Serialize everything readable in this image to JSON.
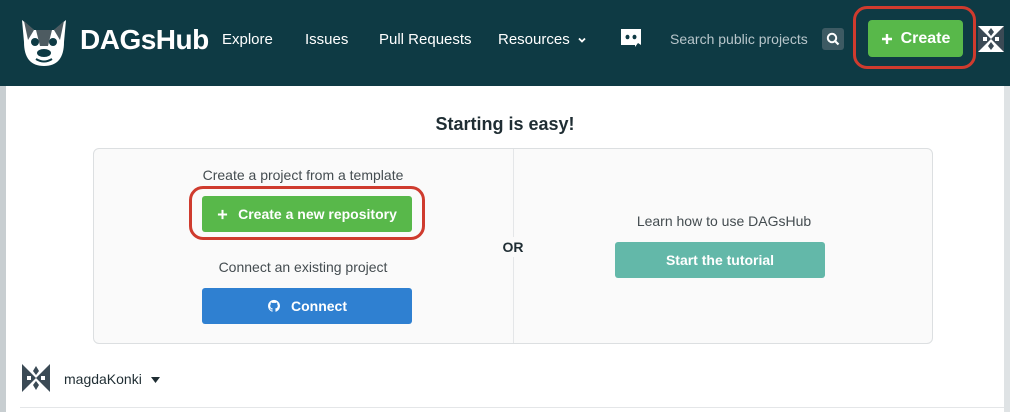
{
  "app": {
    "brand": "DAGsHub"
  },
  "nav": {
    "items": [
      {
        "label": "Explore"
      },
      {
        "label": "Issues"
      },
      {
        "label": "Pull Requests"
      },
      {
        "label": "Resources"
      }
    ]
  },
  "search": {
    "placeholder": "Search public projects..."
  },
  "header": {
    "create_label": "Create"
  },
  "main": {
    "heading": "Starting is easy!",
    "template_caption": "Create a project from a template",
    "new_repo_label": "Create a new repository",
    "connect_caption": "Connect an existing project",
    "connect_label": "Connect",
    "or_label": "OR",
    "tutorial_caption": "Learn how to use DAGsHub",
    "tutorial_label": "Start the tutorial"
  },
  "user": {
    "name": "magdaKonki"
  },
  "colors": {
    "topbar": "#0e3a44",
    "create_green": "#58b84a",
    "connect_blue": "#2f80d1",
    "tutorial_teal": "#63b8a9",
    "highlight_red": "#cf3b2e"
  },
  "icons": [
    "dagshub-dog-logo-icon",
    "chevron-down-icon",
    "discord-icon",
    "search-icon",
    "plus-icon",
    "github-icon",
    "caret-down-icon",
    "identicon-avatar"
  ]
}
